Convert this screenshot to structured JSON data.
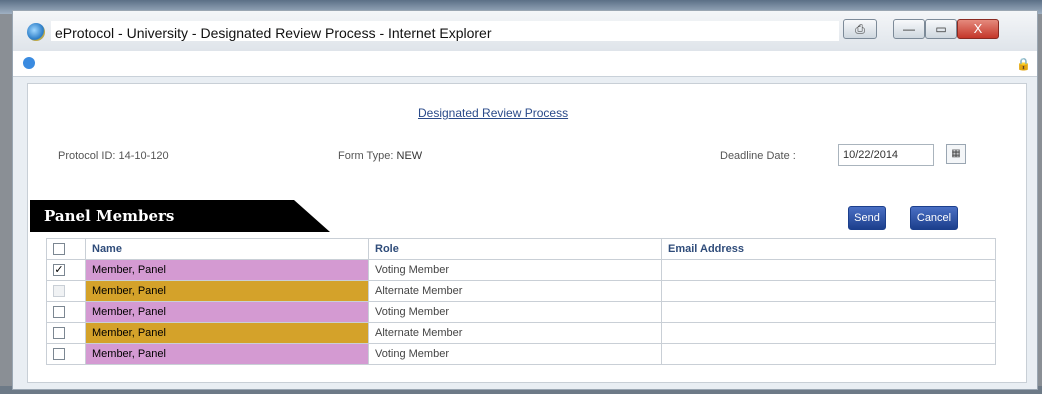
{
  "window": {
    "title": "eProtocol - University - Designated Review Process - Internet Explorer",
    "buttons": {
      "close": "X"
    }
  },
  "page": {
    "title": "Designated Review Process",
    "protocol_id_label": "Protocol ID: 14-10-120",
    "form_type_label": "Form Type:",
    "form_type_value": "NEW",
    "deadline_label": "Deadline Date :",
    "deadline_value": "10/22/2014"
  },
  "panel": {
    "title": "Panel Members",
    "send_label": "Send",
    "cancel_label": "Cancel",
    "columns": [
      "Name",
      "Role",
      "Email Address"
    ],
    "rows": [
      {
        "name": "Member, Panel",
        "role": "Voting Member",
        "email": "",
        "checked": true,
        "enabled": true,
        "color": "#d49ad2"
      },
      {
        "name": "Member, Panel",
        "role": "Alternate Member",
        "email": "",
        "checked": false,
        "enabled": false,
        "color": "#d4a22a"
      },
      {
        "name": "Member, Panel",
        "role": "Voting Member",
        "email": "",
        "checked": false,
        "enabled": true,
        "color": "#d49ad2"
      },
      {
        "name": "Member, Panel",
        "role": "Alternate Member",
        "email": "",
        "checked": false,
        "enabled": true,
        "color": "#d4a22a"
      },
      {
        "name": "Member, Panel",
        "role": "Voting Member",
        "email": "",
        "checked": false,
        "enabled": true,
        "color": "#d49ad2"
      }
    ]
  },
  "icons": {
    "app": "ie-logo-icon",
    "lock": "lock-icon",
    "calendar": "calendar-icon"
  }
}
